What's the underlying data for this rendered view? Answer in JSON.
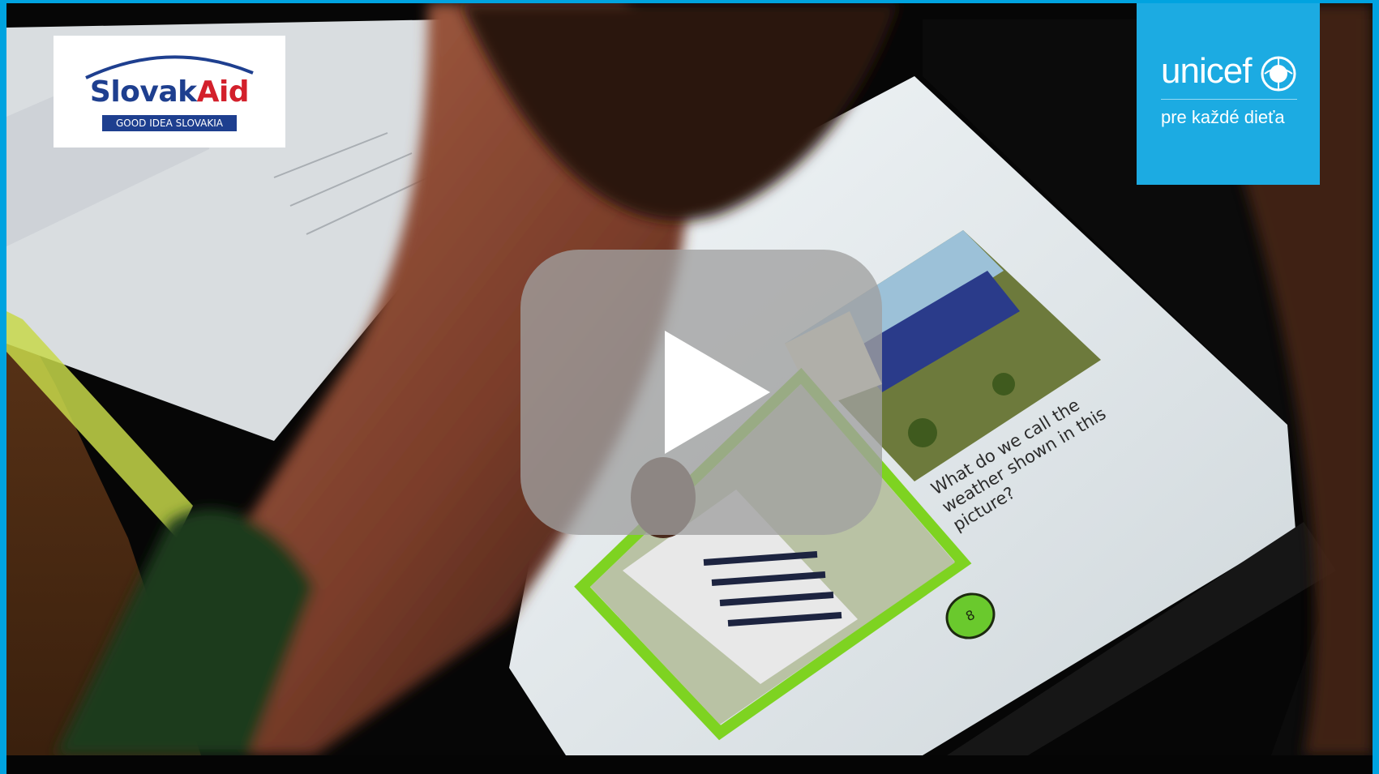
{
  "video": {
    "state": "paused",
    "play_button_icon": "play-icon"
  },
  "slovakaid": {
    "brand_part1": "Slovak",
    "brand_part2": "Aid",
    "tagline": "GOOD IDEA SLOVAKIA"
  },
  "unicef": {
    "brand": "unicef",
    "tagline": "pre každé dieťa",
    "globe_icon": "unicef-globe-icon"
  },
  "tablet_content": {
    "question": "What do we call the\nweather shown in this\npicture?",
    "page_number": "8"
  },
  "colors": {
    "frame_border": "#00a3e0",
    "unicef_blue": "#1cabe2",
    "slovakaid_blue": "#1e3f8f",
    "slovakaid_red": "#d3202b",
    "page_badge": "#6ac92d",
    "picture_frame": "#7ed321"
  }
}
